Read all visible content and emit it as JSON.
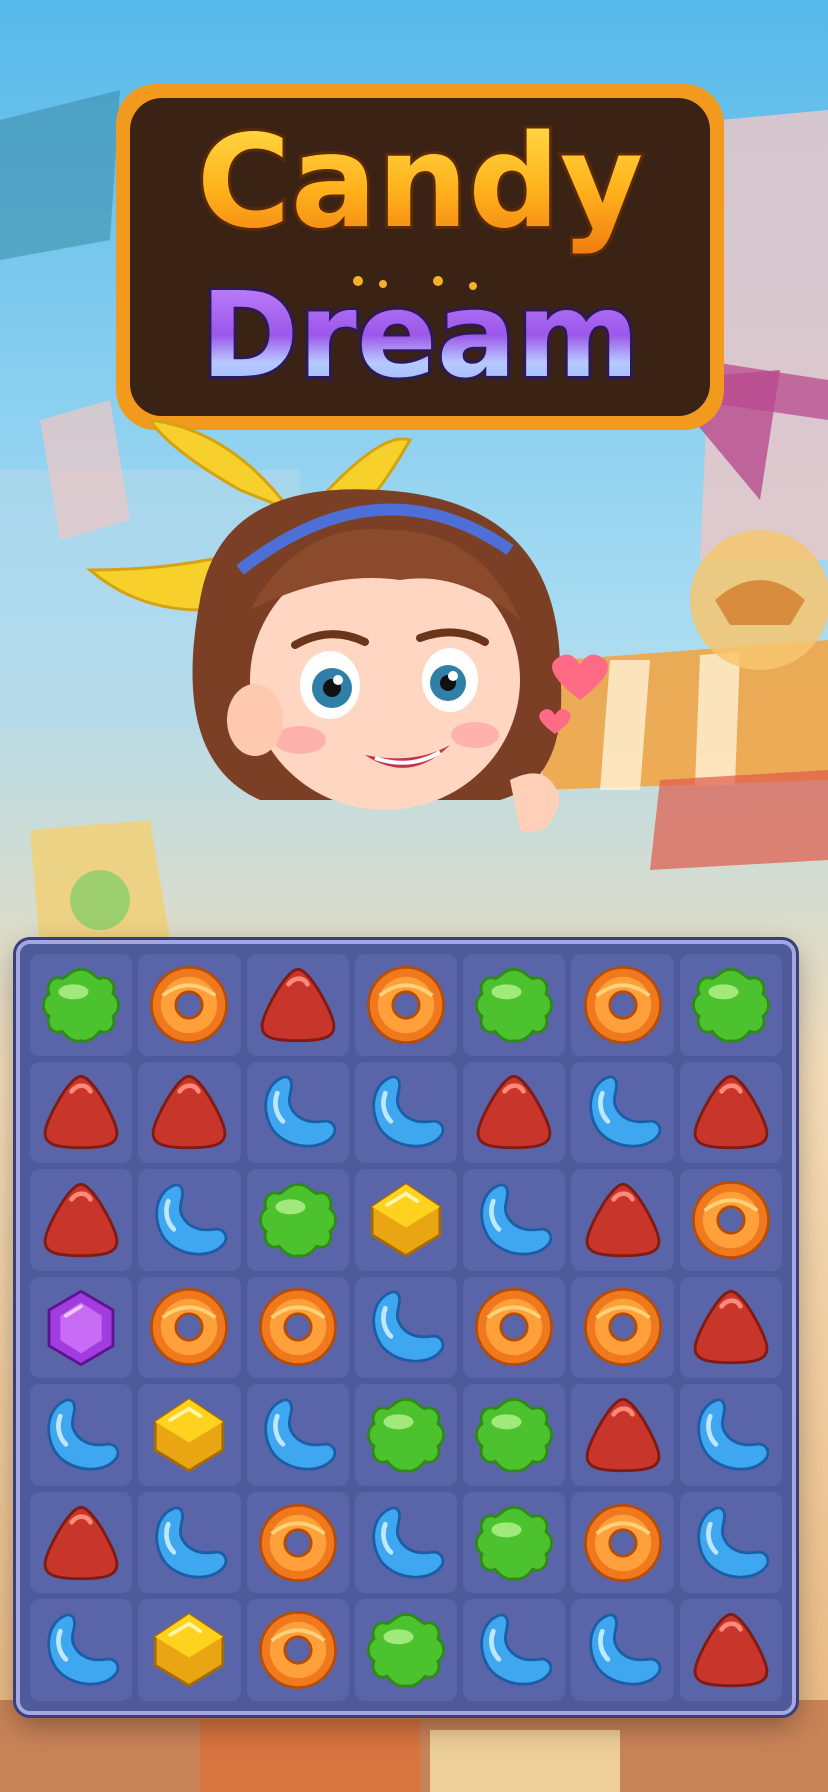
{
  "logo": {
    "line1": "Candy",
    "line2": "Dream"
  },
  "colors": {
    "board": "#4f5a9a",
    "cell": "#5a64a8",
    "green": "#4cc22e",
    "orange": "#f0791d",
    "red": "#c8352a",
    "blue": "#3fa7f0",
    "yellow": "#ffd21f",
    "purple": "#a23be0"
  },
  "board": {
    "rows": [
      [
        "green",
        "orange",
        "red",
        "orange",
        "green",
        "orange",
        "green"
      ],
      [
        "red",
        "red",
        "blue",
        "blue",
        "red",
        "blue",
        "red"
      ],
      [
        "red",
        "blue",
        "green",
        "yellow",
        "blue",
        "red",
        "orange"
      ],
      [
        "purple",
        "orange",
        "orange",
        "blue",
        "orange",
        "orange",
        "red"
      ],
      [
        "blue",
        "yellow",
        "blue",
        "green",
        "green",
        "red",
        "blue"
      ],
      [
        "red",
        "blue",
        "orange",
        "blue",
        "green",
        "orange",
        "blue"
      ],
      [
        "blue",
        "yellow",
        "orange",
        "green",
        "blue",
        "blue",
        "red"
      ]
    ]
  },
  "candy_icons": {
    "green": "green-jelly-flower-icon",
    "orange": "orange-donut-icon",
    "red": "red-gumdrop-icon",
    "blue": "blue-jellybean-icon",
    "yellow": "yellow-cube-icon",
    "purple": "purple-hexagon-icon"
  }
}
